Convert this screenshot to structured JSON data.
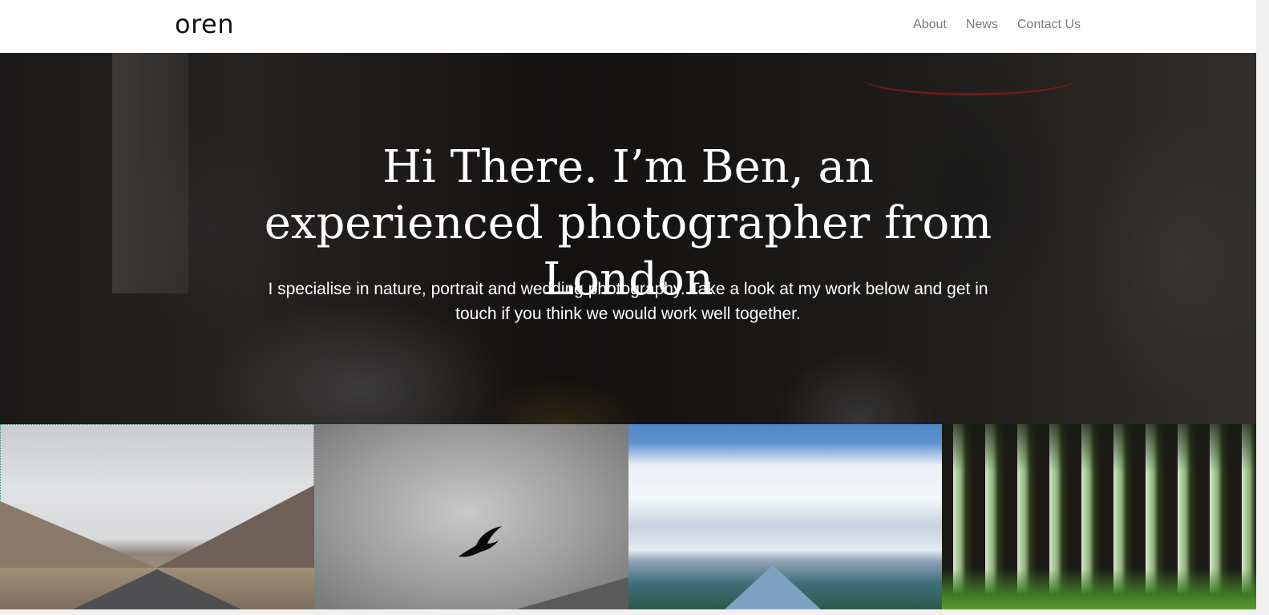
{
  "header": {
    "logo": "oren",
    "nav": [
      "About",
      "News",
      "Contact Us"
    ]
  },
  "hero": {
    "title": "Hi There. I’m Ben, an experienced photographer from London",
    "subtitle": "I specialise in nature, portrait and wedding photography. Take a look at my work below and get in touch if you think we would work well together."
  },
  "gallery": {
    "tiles": [
      "mountain-road",
      "bird-in-clouds",
      "fjord-lake",
      "pine-forest"
    ]
  },
  "colors": {
    "header_bg": "#ffffff",
    "nav_text": "#7a7a7a",
    "logo_text": "#111111",
    "hero_text": "#ffffff"
  }
}
